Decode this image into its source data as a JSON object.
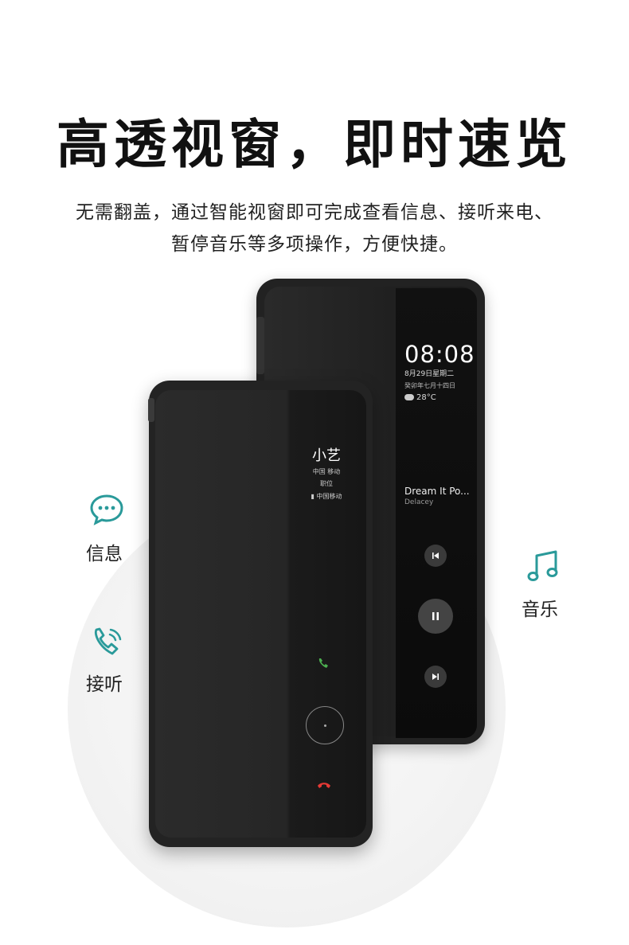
{
  "header": {
    "title": "高透视窗，即时速览",
    "subtitle_line1": "无需翻盖，通过智能视窗即可完成查看信息、接听来电、",
    "subtitle_line2": "暂停音乐等多项操作，方便快捷。"
  },
  "features": {
    "message": {
      "label": "信息",
      "icon": "chat-bubble-icon"
    },
    "call": {
      "label": "接听",
      "icon": "phone-ring-icon"
    },
    "music": {
      "label": "音乐",
      "icon": "music-note-icon"
    }
  },
  "back_phone": {
    "time": "08:08",
    "date": "8月29日星期二",
    "lunar_date": "癸卯年七月十四日",
    "weather": "28°C",
    "song_title": "Dream It Po...",
    "song_artist": "Delacey"
  },
  "front_phone": {
    "caller_name": "小艺",
    "caller_carrier": "中国 移动",
    "caller_title": "职位",
    "sim_label": "中国移动"
  },
  "colors": {
    "accent_teal": "#2a9a9a",
    "answer_green": "#4caf50",
    "decline_red": "#e53935"
  }
}
